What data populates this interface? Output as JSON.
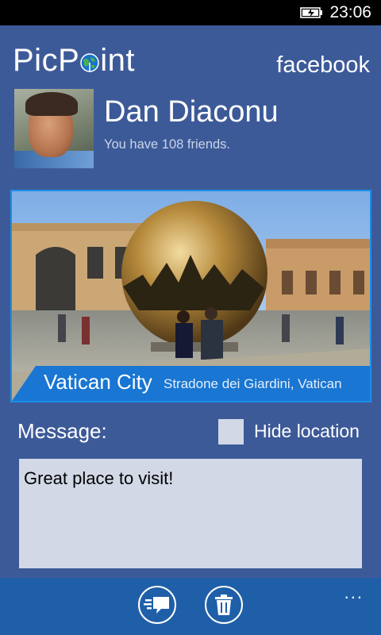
{
  "status": {
    "time": "23:06",
    "battery_icon": "battery-charging-icon"
  },
  "header": {
    "brand_prefix": "PicP",
    "brand_suffix": "int",
    "brand_icon": "globe-icon",
    "network": "facebook"
  },
  "profile": {
    "name": "Dan Diaconu",
    "friends_text": "You have 108 friends."
  },
  "photo": {
    "city": "Vatican City",
    "street": "Stradone dei Giardini, Vatican"
  },
  "compose": {
    "message_label": "Message:",
    "hide_location_label": "Hide location",
    "hide_location_checked": false,
    "message_value": "Great place to visit!"
  },
  "appbar": {
    "buttons": [
      "post-icon",
      "delete-icon"
    ],
    "more_label": "..."
  },
  "colors": {
    "background": "#3d5a98",
    "accent": "#1976d2",
    "appbar": "#1f5fa8"
  }
}
